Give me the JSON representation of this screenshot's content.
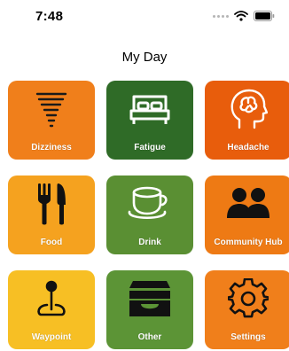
{
  "status_bar": {
    "time": "7:48"
  },
  "page": {
    "title": "My Day"
  },
  "tiles": [
    {
      "label": "Dizziness",
      "color": "#F07F1B",
      "icon": "tornado-icon"
    },
    {
      "label": "Fatigue",
      "color": "#2F6B27",
      "icon": "bed-icon"
    },
    {
      "label": "Headache",
      "color": "#E85D0C",
      "icon": "head-brain-icon"
    },
    {
      "label": "Food",
      "color": "#F5A21F",
      "icon": "utensils-icon"
    },
    {
      "label": "Drink",
      "color": "#5A8F33",
      "icon": "cup-icon"
    },
    {
      "label": "Community Hub",
      "color": "#EE7A14",
      "icon": "people-icon"
    },
    {
      "label": "Waypoint",
      "color": "#F7BF24",
      "icon": "map-pin-icon"
    },
    {
      "label": "Other",
      "color": "#5C9436",
      "icon": "inbox-icon"
    },
    {
      "label": "Settings",
      "color": "#F07F1B",
      "icon": "gear-icon"
    }
  ]
}
